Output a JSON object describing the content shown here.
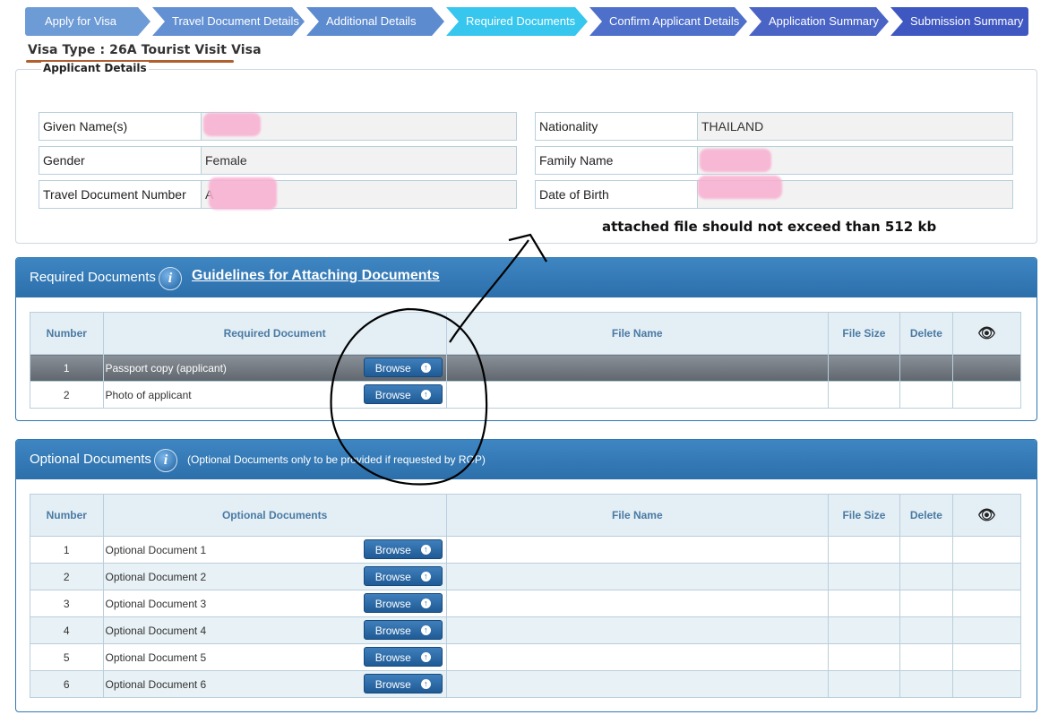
{
  "wizard": {
    "steps": [
      "Apply for Visa",
      "Travel Document Details",
      "Additional Details",
      "Required Documents",
      "Confirm Applicant Details",
      "Application Summary",
      "Submission Summary"
    ]
  },
  "visa_type": "Visa Type  : 26A Tourist Visit Visa",
  "applicant": {
    "legend": "Applicant Details",
    "given_name_label": "Given Name(s)",
    "gender_label": "Gender",
    "gender_value": "Female",
    "travel_doc_label": "Travel Document Number",
    "travel_doc_value": "A",
    "nationality_label": "Nationality",
    "nationality_value": "THAILAND",
    "family_name_label": "Family Name",
    "dob_label": "Date of Birth"
  },
  "note": "attached file should not exceed than 512 kb",
  "required": {
    "title": "Required Documents",
    "link": "Guidelines for Attaching Documents",
    "headers": [
      "Number",
      "Required Document",
      "File Name",
      "File Size",
      "Delete"
    ],
    "rows": [
      {
        "num": "1",
        "doc": "Passport copy (applicant)"
      },
      {
        "num": "2",
        "doc": "Photo of applicant"
      }
    ]
  },
  "optional": {
    "title": "Optional Documents",
    "note": "(Optional Documents only to be provided if requested by ROP)",
    "headers": [
      "Number",
      "Optional Documents",
      "File Name",
      "File Size",
      "Delete"
    ],
    "rows": [
      {
        "num": "1",
        "doc": "Optional Document 1"
      },
      {
        "num": "2",
        "doc": "Optional Document 2"
      },
      {
        "num": "3",
        "doc": "Optional Document 3"
      },
      {
        "num": "4",
        "doc": "Optional Document 4"
      },
      {
        "num": "5",
        "doc": "Optional Document 5"
      },
      {
        "num": "6",
        "doc": "Optional Document 6"
      }
    ]
  },
  "browse_label": "Browse",
  "icons": {
    "info": "info-icon",
    "eye": "eye-icon",
    "upload": "upload-icon"
  }
}
